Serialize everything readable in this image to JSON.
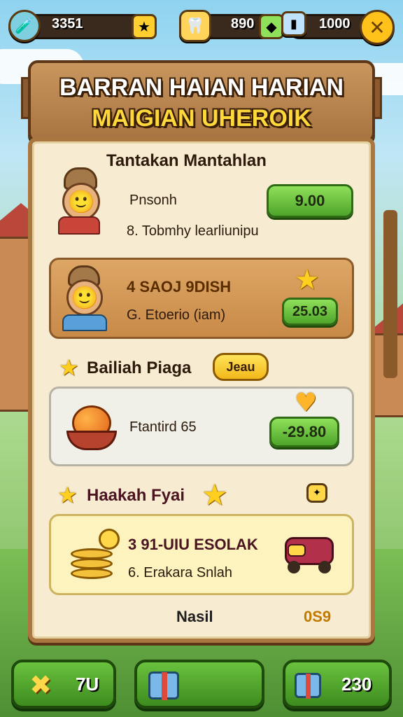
{
  "topbar": {
    "resource1_value": "3351",
    "resource2_value": "890",
    "resource3_value": "1000",
    "icons": [
      "paint-tube-icon",
      "star-plus-icon",
      "tooth-icon",
      "gem-icon",
      "battery-icon",
      "close-icon"
    ]
  },
  "banner": {
    "title_line1": "BARRAN HAIAN HARIAN",
    "title_line2": "MAIGIAN UHEROIK"
  },
  "section1": {
    "heading": "Tantakan Mantahlan",
    "card1": {
      "name": "Pnsonh",
      "subtitle": "8. Tobmhy learliunipu",
      "button": "9.00"
    },
    "card2": {
      "name": "4 SAOJ 9DISH",
      "subtitle": "G. Etoerio (iam)",
      "button": "25.03"
    }
  },
  "section2": {
    "heading": "Bailiah Piaga",
    "badge": "Jeau",
    "card": {
      "name": "Ftantird 65",
      "button": "-29.80"
    }
  },
  "section3": {
    "heading": "Haakah Fyai",
    "card": {
      "name": "3 91-UIU ESOLAK",
      "subtitle": "6. Erakara Snlah"
    }
  },
  "footer": {
    "left_label": "Nasil",
    "right_label": "0S9"
  },
  "bottombar": {
    "btn1_value": "7U",
    "btn3_value": "230"
  },
  "colors": {
    "accent_green": "#4ea52a",
    "accent_yellow": "#ffd93b",
    "panel_bg": "#f7ecd2",
    "wood": "#a87340"
  }
}
